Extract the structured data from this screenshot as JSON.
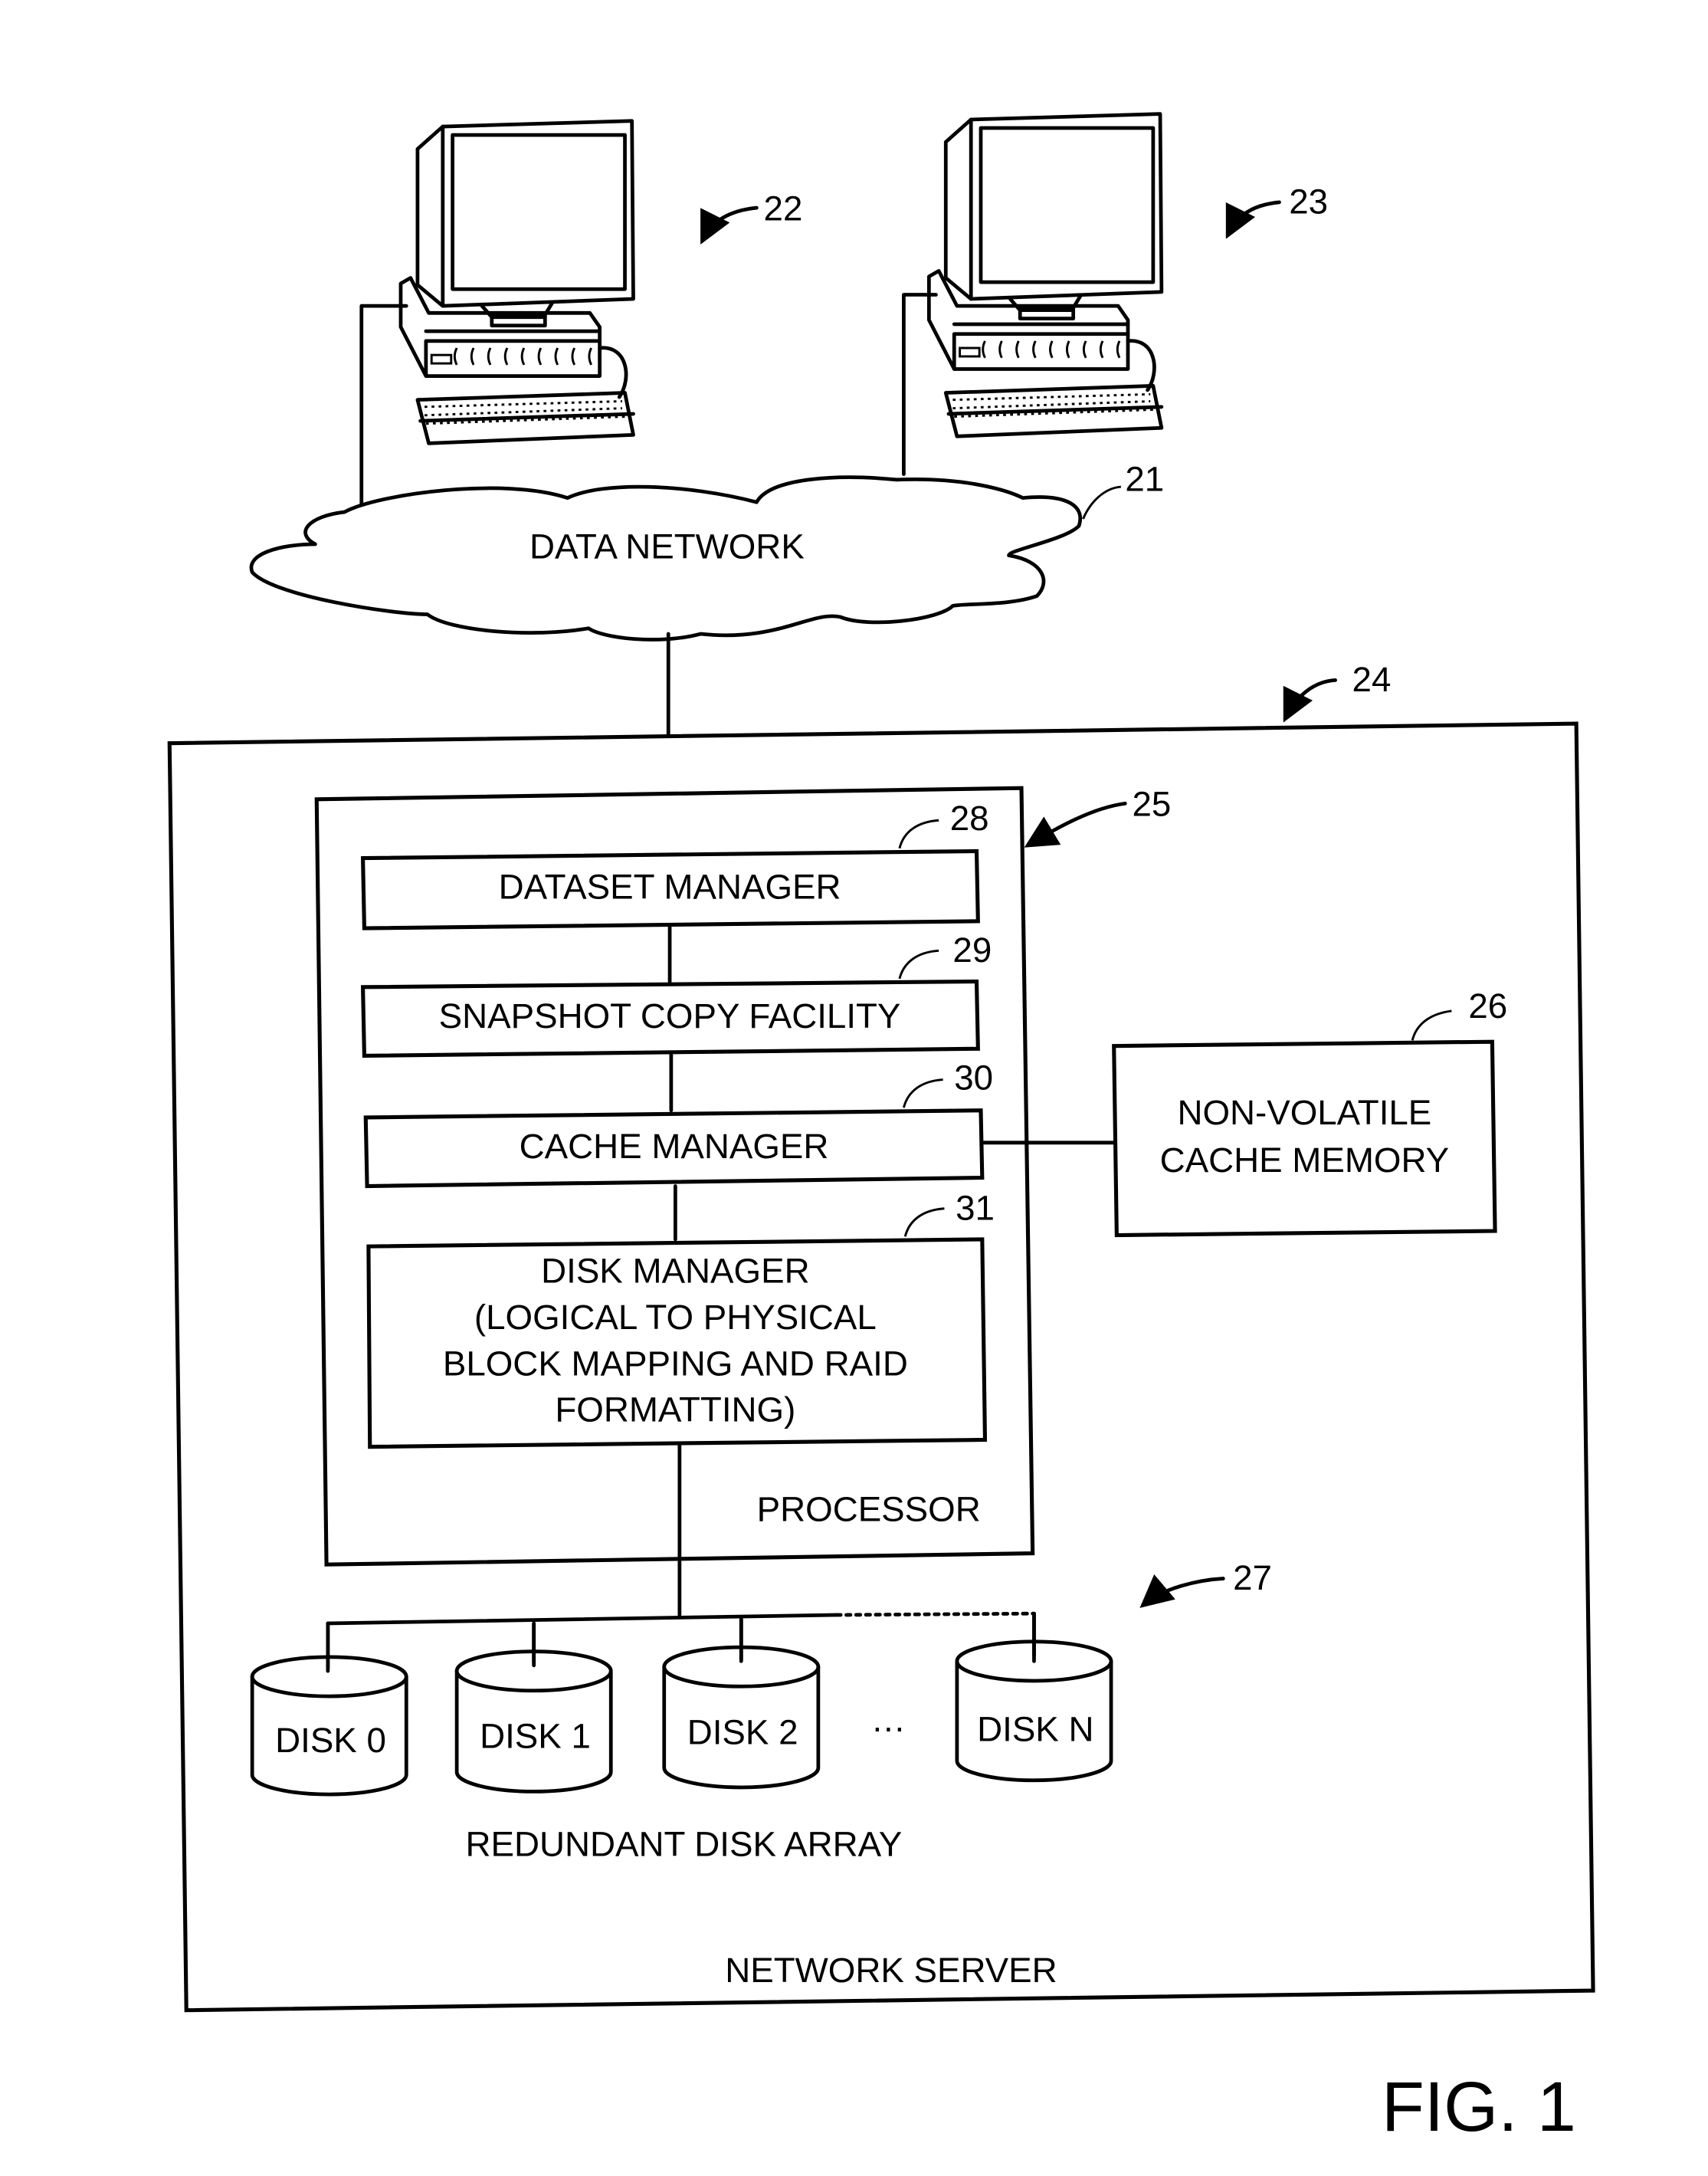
{
  "figure": {
    "label": "FIG. 1"
  },
  "computers": [
    {
      "ref": "22"
    },
    {
      "ref": "23"
    }
  ],
  "network": {
    "label": "DATA NETWORK",
    "ref": "21"
  },
  "server": {
    "label": "NETWORK SERVER",
    "ref": "24"
  },
  "processor": {
    "label": "PROCESSOR",
    "ref": "25",
    "modules": [
      {
        "ref": "28",
        "lines": [
          "DATASET MANAGER"
        ]
      },
      {
        "ref": "29",
        "lines": [
          "SNAPSHOT COPY FACILITY"
        ]
      },
      {
        "ref": "30",
        "lines": [
          "CACHE MANAGER"
        ]
      },
      {
        "ref": "31",
        "lines": [
          "DISK MANAGER",
          "(LOGICAL TO PHYSICAL",
          "BLOCK MAPPING AND RAID",
          "FORMATTING)"
        ]
      }
    ]
  },
  "cache_memory": {
    "ref": "26",
    "lines": [
      "NON-VOLATILE",
      "CACHE MEMORY"
    ]
  },
  "disk_array": {
    "label": "REDUNDANT DISK ARRAY",
    "ref": "27",
    "ellipsis": "…",
    "disks": [
      "DISK 0",
      "DISK 1",
      "DISK 2",
      "DISK N"
    ]
  }
}
